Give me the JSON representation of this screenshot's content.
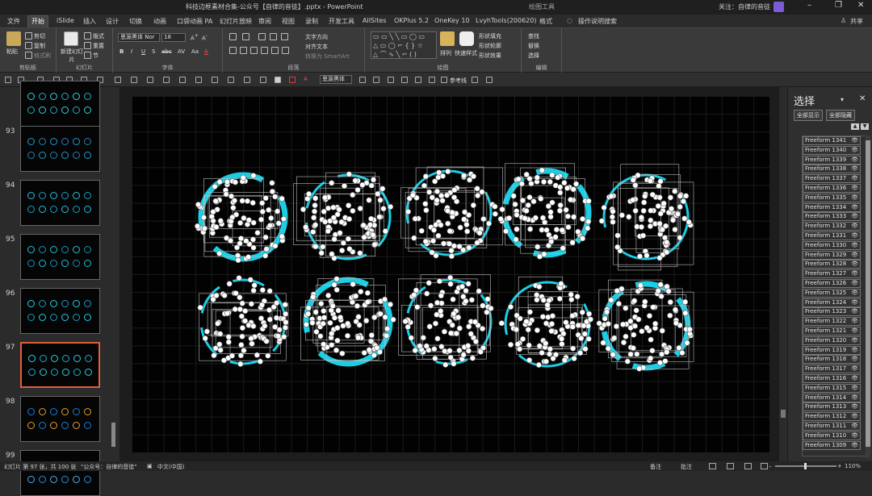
{
  "titlebar": {
    "doc_title": "科技边框素材合集-公众号【自律的音徒】.pptx  -  PowerPoint",
    "context_tab": "绘图工具",
    "account": "关注：自律的音徒",
    "min": "–",
    "restore": "❐",
    "close": "✕"
  },
  "tabs": [
    "文件",
    "开始",
    "iSlide",
    "插入",
    "设计",
    "切换",
    "动画",
    "口袋动画 PA",
    "幻灯片放映",
    "审阅",
    "视图",
    "录制",
    "开发工具",
    "AllSites",
    "OKPlus 5.2",
    "OneKey 10",
    "LvyhTools(200620)",
    "格式"
  ],
  "tell_me": "操作说明搜索",
  "share": "共享",
  "ribbon": {
    "clipboard": {
      "label": "剪贴板",
      "paste": "粘贴",
      "cut": "剪切",
      "copy": "复制",
      "format_painter": "格式刷"
    },
    "slides": {
      "label": "幻灯片",
      "new_slide": "新建幻灯片",
      "layout": "版式",
      "reset": "重置",
      "section": "节"
    },
    "font": {
      "label": "字体",
      "font_name": "思源黑体 Nor",
      "font_size": "18",
      "bold": "B",
      "italic": "I",
      "underline": "U",
      "shadow": "S",
      "strike": "abc",
      "char_space": "AV",
      "case": "Aa",
      "color": "A"
    },
    "paragraph": {
      "label": "段落",
      "text_direction": "文字方向",
      "align_text": "对齐文本",
      "smartart": "转换为 SmartArt"
    },
    "drawing": {
      "label": "绘图",
      "arrange": "排列",
      "quick_styles": "快速样式",
      "shape_fill": "形状填充",
      "shape_outline": "形状轮廓",
      "shape_effects": "形状效果"
    },
    "editing": {
      "label": "编辑",
      "find": "查找",
      "replace": "替换",
      "select": "选择"
    }
  },
  "qat": {
    "font_name": "思源黑体",
    "ref_line": "参考线"
  },
  "slides": [
    {
      "num": "",
      "colors": [
        "#35d0e0",
        "#2aa9c4"
      ]
    },
    {
      "num": "93",
      "colors": [
        "#1f9ccf",
        "#2a7fb0"
      ]
    },
    {
      "num": "94",
      "colors": [
        "#27c3de",
        "#1aa0c8"
      ]
    },
    {
      "num": "95",
      "colors": [
        "#20c5d5",
        "#1e90b0"
      ]
    },
    {
      "num": "96",
      "colors": [
        "#22d1e3",
        "#1b9cc0"
      ]
    },
    {
      "num": "97",
      "colors": [
        "#22d6e8",
        "#19b0d0"
      ]
    },
    {
      "num": "98",
      "colors": [
        "#1c7ed6",
        "#e0a030"
      ]
    },
    {
      "num": "99",
      "colors": [
        "#2a8fe0",
        "#4bb0f0"
      ]
    }
  ],
  "selected_slide": "97",
  "selection_pane": {
    "title": "选择",
    "menu": "▾",
    "close": "✕",
    "show_all": "全部显示",
    "hide_all": "全部隐藏",
    "up": "▲",
    "down": "▼",
    "eye": "👁",
    "items": [
      "Freeform 1341",
      "Freeform 1340",
      "Freeform 1339",
      "Freeform 1338",
      "Freeform 1337",
      "Freeform 1336",
      "Freeform 1335",
      "Freeform 1334",
      "Freeform 1333",
      "Freeform 1332",
      "Freeform 1331",
      "Freeform 1330",
      "Freeform 1329",
      "Freeform 1328",
      "Freeform 1327",
      "Freeform 1326",
      "Freeform 1325",
      "Freeform 1324",
      "Freeform 1323",
      "Freeform 1322",
      "Freeform 1321",
      "Freeform 1320",
      "Freeform 1319",
      "Freeform 1318",
      "Freeform 1317",
      "Freeform 1316",
      "Freeform 1315",
      "Freeform 1314",
      "Freeform 1313",
      "Freeform 1312",
      "Freeform 1311",
      "Freeform 1310",
      "Freeform 1309"
    ]
  },
  "status": {
    "slide_info": "幻灯片 第 97 张，共 100 张",
    "theme": "\"公众号：自律的音徒\"",
    "lang": "中文(中国)",
    "notes": "备注",
    "comments": "批注",
    "zoom": "110%",
    "minus": "–",
    "plus": "+"
  },
  "colors": {
    "accent": "#19cfe6",
    "selected_border": "#e0603c",
    "handle": "#ffffff"
  }
}
